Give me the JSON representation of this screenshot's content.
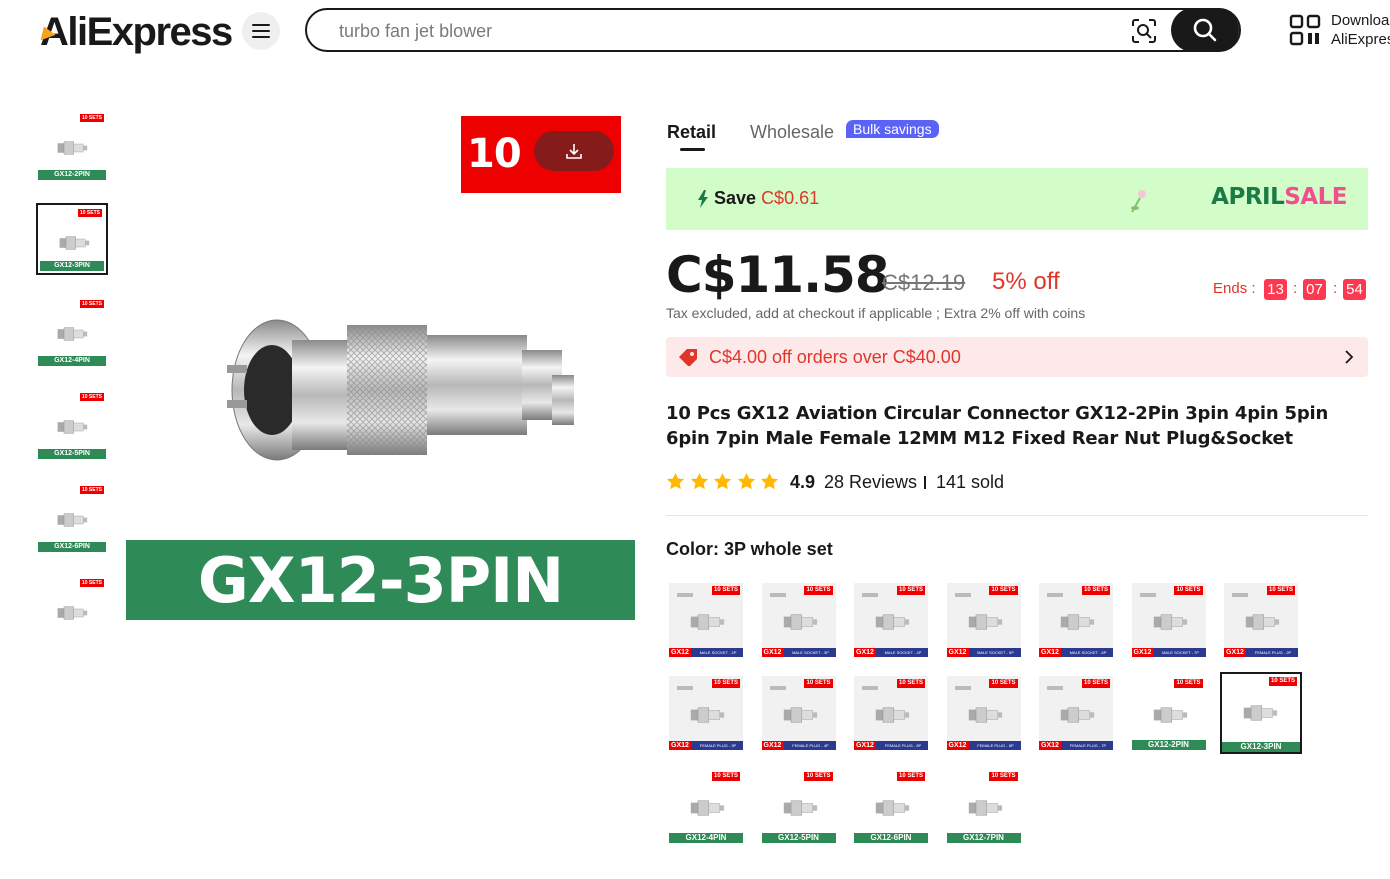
{
  "header": {
    "logo_text": "AliExpress",
    "search_placeholder": "turbo fan jet blower",
    "download_line1": "Download",
    "download_line2": "AliExpress"
  },
  "gallery": {
    "thumbnails": [
      {
        "label": "GX12-2PIN",
        "tag": "10 SETS",
        "selected": false
      },
      {
        "label": "GX12-3PIN",
        "tag": "10 SETS",
        "selected": true
      },
      {
        "label": "GX12-4PIN",
        "tag": "10 SETS",
        "selected": false
      },
      {
        "label": "GX12-5PIN",
        "tag": "10 SETS",
        "selected": false
      },
      {
        "label": "GX12-6PIN",
        "tag": "10 SETS",
        "selected": false
      },
      {
        "label": "",
        "tag": "10 SETS",
        "selected": false
      }
    ],
    "main_red_text": "10 SETS",
    "main_green_text": "GX12-3PIN"
  },
  "tabs": {
    "retail": "Retail",
    "wholesale": "Wholesale",
    "bulk_badge": "Bulk savings"
  },
  "promo": {
    "save_label": "Save",
    "save_amount": "C$0.61",
    "sale_word1": "APRIL",
    "sale_word2": "SALE"
  },
  "pricing": {
    "price": "C$11.58",
    "original_price": "C$12.19",
    "discount": "5% off",
    "ends_label": "Ends :",
    "countdown": [
      "13",
      "07",
      "54"
    ],
    "tax_note": "Tax excluded, add at checkout if applicable ; Extra 2% off with coins"
  },
  "coupon": {
    "text": "C$4.00 off orders over C$40.00"
  },
  "product": {
    "title": "10 Pcs GX12 Aviation Circular Connector GX12-2Pin 3pin 4pin 5pin 6pin 7pin Male Female 12MM M12 Fixed Rear Nut Plug&Socket",
    "rating": "4.9",
    "reviews": "28 Reviews",
    "sold": "141 sold",
    "star_count": 5
  },
  "variants": {
    "label": "Color: 3P whole set",
    "swatches": [
      {
        "style": "blue",
        "gx": "GX12",
        "foot": "MALE SOCKET - 2P",
        "tag": "10 SETS"
      },
      {
        "style": "blue",
        "gx": "GX12",
        "foot": "MALE SOCKET - 3P",
        "tag": "10 SETS"
      },
      {
        "style": "blue",
        "gx": "GX12",
        "foot": "MALE SOCKET - 4P",
        "tag": "10 SETS"
      },
      {
        "style": "blue",
        "gx": "GX12",
        "foot": "MALE SOCKET - 5P",
        "tag": "10 SETS"
      },
      {
        "style": "blue",
        "gx": "GX12",
        "foot": "MALE SOCKET - 6P",
        "tag": "10 SETS"
      },
      {
        "style": "blue",
        "gx": "GX12",
        "foot": "MALE SOCKET - 7P",
        "tag": "10 SETS"
      },
      {
        "style": "blue",
        "gx": "GX12",
        "foot": "FEMALE PLUG - 2P",
        "tag": "10 SETS"
      },
      {
        "style": "blue",
        "gx": "GX12",
        "foot": "FEMALE PLUG - 3P",
        "tag": "10 SETS"
      },
      {
        "style": "blue",
        "gx": "GX12",
        "foot": "FEMALE PLUG - 4P",
        "tag": "10 SETS"
      },
      {
        "style": "blue",
        "gx": "GX12",
        "foot": "FEMALE PLUG - 5P",
        "tag": "10 SETS"
      },
      {
        "style": "blue",
        "gx": "GX12",
        "foot": "FEMALE PLUG - 6P",
        "tag": "10 SETS"
      },
      {
        "style": "blue",
        "gx": "GX12",
        "foot": "FEMALE PLUG - 7P",
        "tag": "10 SETS"
      },
      {
        "style": "green",
        "gx": "",
        "foot": "GX12-2PIN",
        "tag": "10 SETS"
      },
      {
        "style": "green",
        "gx": "",
        "foot": "GX12-3PIN",
        "tag": "10 SETS",
        "selected": true
      },
      {
        "style": "green",
        "gx": "",
        "foot": "GX12-4PIN",
        "tag": "10 SETS"
      },
      {
        "style": "green",
        "gx": "",
        "foot": "GX12-5PIN",
        "tag": "10 SETS"
      },
      {
        "style": "green",
        "gx": "",
        "foot": "GX12-6PIN",
        "tag": "10 SETS"
      },
      {
        "style": "green",
        "gx": "",
        "foot": "GX12-7PIN",
        "tag": "10 SETS"
      }
    ]
  },
  "colors": {
    "accent_red": "#e0362a",
    "sale_banner_bg": "#d3fdc8",
    "bulk_badge": "#5a63f5",
    "green_label": "#2e8b57",
    "star": "#ffb700"
  }
}
